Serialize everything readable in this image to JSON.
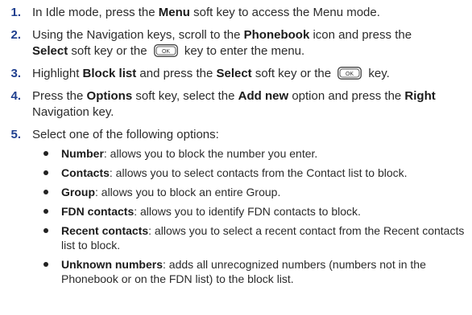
{
  "steps": [
    {
      "n": "1.",
      "t1": "In Idle mode, press the ",
      "b1": "Menu",
      "t2": " soft key to access the Menu mode."
    },
    {
      "n": "2.",
      "t1": "Using the Navigation keys, scroll to the ",
      "b1": "Phonebook",
      "t2": " icon and press the ",
      "b2": "Select",
      "t3": " soft key or the ",
      "t4": " key to enter the menu."
    },
    {
      "n": "3.",
      "t1": "Highlight ",
      "b1": "Block list",
      "t2": " and press the ",
      "b2": "Select",
      "t3": " soft key or the ",
      "t4": " key."
    },
    {
      "n": "4.",
      "t1": "Press the ",
      "b1": "Options",
      "t2": " soft key, select the ",
      "b2": "Add new",
      "t3": " option and press the ",
      "b3": "Right",
      "t4": " Navigation key."
    },
    {
      "n": "5.",
      "t1": "Select one of the following options:"
    }
  ],
  "key_label": "OK",
  "options": [
    {
      "b": "Number",
      "t": ": allows you to block the number you enter."
    },
    {
      "b": "Contacts",
      "t": ": allows you to select contacts from the Contact list to block."
    },
    {
      "b": "Group",
      "t": ": allows you to block an entire Group."
    },
    {
      "b": "FDN contacts",
      "t": ": allows you to identify FDN contacts to block."
    },
    {
      "b": "Recent contacts",
      "t": ": allows you to select a recent contact from the Recent contacts list to block."
    },
    {
      "b": "Unknown numbers",
      "t": ": adds all unrecognized numbers (numbers not in the Phonebook or on the FDN list) to the block list."
    }
  ]
}
